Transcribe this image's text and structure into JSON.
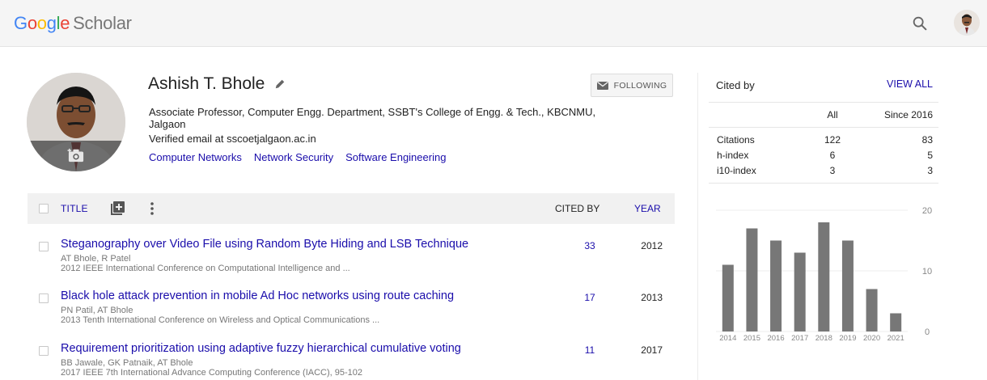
{
  "header": {
    "logo": {
      "g1": "G",
      "o1": "o",
      "o2": "o",
      "g2": "g",
      "l": "l",
      "e": "e",
      "scholar": "Scholar"
    },
    "search_icon": "search-icon",
    "avatar_icon": "user-avatar"
  },
  "profile": {
    "name": "Ashish T. Bhole",
    "affiliation": "Associate Professor, Computer Engg. Department, SSBT's College of Engg. & Tech., KBCNMU, Jalgaon",
    "email": "Verified email at sscoetjalgaon.ac.in",
    "interests": [
      "Computer Networks",
      "Network Security",
      "Software Engineering"
    ],
    "follow_label": "FOLLOWING"
  },
  "table": {
    "title_header": "TITLE",
    "cited_by_header": "CITED BY",
    "year_header": "YEAR",
    "rows": [
      {
        "title": "Steganography over Video File using Random Byte Hiding and LSB Technique",
        "authors": "AT Bhole, R Patel",
        "venue": "2012 IEEE International Conference on Computational Intelligence and ...",
        "cited_by": "33",
        "year": "2012"
      },
      {
        "title": "Black hole attack prevention in mobile Ad Hoc networks using route caching",
        "authors": "PN Patil, AT Bhole",
        "venue": "2013 Tenth International Conference on Wireless and Optical Communications ...",
        "cited_by": "17",
        "year": "2013"
      },
      {
        "title": "Requirement prioritization using adaptive fuzzy hierarchical cumulative voting",
        "authors": "BB Jawale, GK Patnaik, AT Bhole",
        "venue": "2017 IEEE 7th International Advance Computing Conference (IACC), 95-102",
        "cited_by": "11",
        "year": "2017"
      }
    ]
  },
  "cited_by": {
    "title": "Cited by",
    "view_all": "VIEW ALL",
    "col_all": "All",
    "col_since": "Since 2016",
    "stats": [
      {
        "label": "Citations",
        "all": "122",
        "since": "83"
      },
      {
        "label": "h-index",
        "all": "6",
        "since": "5"
      },
      {
        "label": "i10-index",
        "all": "3",
        "since": "3"
      }
    ]
  },
  "chart_data": {
    "type": "bar",
    "categories": [
      "2014",
      "2015",
      "2016",
      "2017",
      "2018",
      "2019",
      "2020",
      "2021"
    ],
    "values": [
      11,
      17,
      15,
      13,
      18,
      15,
      7,
      3
    ],
    "ylim": [
      0,
      20
    ],
    "yticks": [
      "0",
      "10",
      "20"
    ],
    "bar_color": "#777777"
  },
  "colors": {
    "link": "#1a0dab",
    "header_bg": "#f5f5f5",
    "bar": "#777777"
  }
}
